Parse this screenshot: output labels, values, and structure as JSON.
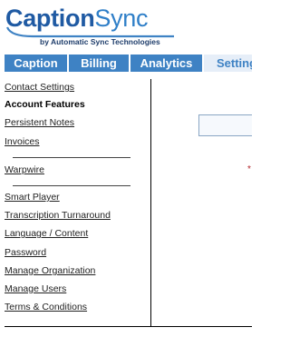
{
  "logo": {
    "word_caption": "Caption",
    "word_sync": "Sync",
    "tagline": "by Automatic Sync Technologies"
  },
  "nav": {
    "tabs": [
      {
        "label": "Caption"
      },
      {
        "label": "Billing"
      },
      {
        "label": "Analytics"
      },
      {
        "label": "Settings",
        "active": true
      }
    ]
  },
  "sidebar": {
    "items": [
      {
        "label": "Contact Settings"
      },
      {
        "label": "Account Features",
        "current": true
      },
      {
        "label": "Persistent Notes"
      },
      {
        "label": "Invoices"
      },
      {
        "label": "Warpwire"
      },
      {
        "label": "Smart Player"
      },
      {
        "label": "Transcription Turnaround"
      },
      {
        "label": "Language / Content"
      },
      {
        "label": "Password"
      },
      {
        "label": "Manage Organization"
      },
      {
        "label": "Manage Users"
      },
      {
        "label": "Terms & Conditions"
      }
    ]
  },
  "main": {
    "required_mark": "*"
  },
  "colors": {
    "brand_blue": "#3e82c4",
    "logo_dark": "#1f5aa3",
    "required_red": "#b3262d"
  }
}
